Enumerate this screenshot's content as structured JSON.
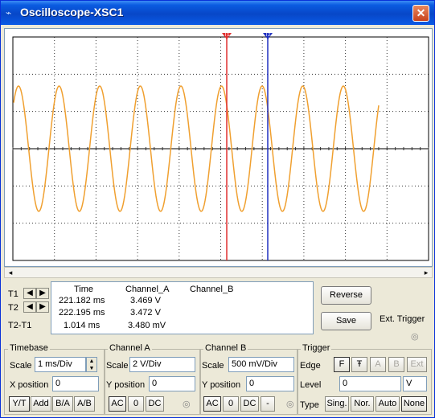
{
  "window": {
    "title": "Oscilloscope-XSC1",
    "close_symbol": "✕"
  },
  "cursors": {
    "t1_marker": "T1",
    "t2_marker": "T2"
  },
  "readout": {
    "headers": {
      "time": "Time",
      "channel_a": "Channel_A",
      "channel_b": "Channel_B"
    },
    "rows": [
      {
        "label": "T1",
        "time": "221.182 ms",
        "channel_a": "3.469 V",
        "channel_b": ""
      },
      {
        "label": "T2",
        "time": "222.195 ms",
        "channel_a": "3.472 V",
        "channel_b": ""
      },
      {
        "label": "T2-T1",
        "time": "1.014 ms",
        "channel_a": "3.480 mV",
        "channel_b": ""
      }
    ]
  },
  "buttons": {
    "reverse": "Reverse",
    "save": "Save",
    "ext_trigger": "Ext. Trigger"
  },
  "timebase": {
    "title": "Timebase",
    "scale_label": "Scale",
    "scale_value": "1 ms/Div",
    "xpos_label": "X position",
    "xpos_value": "0",
    "modes": [
      "Y/T",
      "Add",
      "B/A",
      "A/B"
    ]
  },
  "channel_a": {
    "title": "Channel A",
    "scale_label": "Scale",
    "scale_value": "2 V/Div",
    "ypos_label": "Y position",
    "ypos_value": "0",
    "coupling": [
      "AC",
      "0",
      "DC"
    ]
  },
  "channel_b": {
    "title": "Channel B",
    "scale_label": "Scale",
    "scale_value": "500 mV/Div",
    "ypos_label": "Y position",
    "ypos_value": "0",
    "coupling": [
      "AC",
      "0",
      "DC",
      "-"
    ]
  },
  "trigger": {
    "title": "Trigger",
    "edge_label": "Edge",
    "edge_buttons": [
      "F",
      "Ŧ",
      "A",
      "B",
      "Ext"
    ],
    "level_label": "Level",
    "level_value": "0",
    "level_unit": "V",
    "type_label": "Type",
    "types": [
      "Sing.",
      "Nor.",
      "Auto",
      "None"
    ]
  },
  "colors": {
    "trace": "#f0a030",
    "cursor_t1": "#e03030",
    "cursor_t2": "#2030c0",
    "grid": "#7a7a7a"
  }
}
